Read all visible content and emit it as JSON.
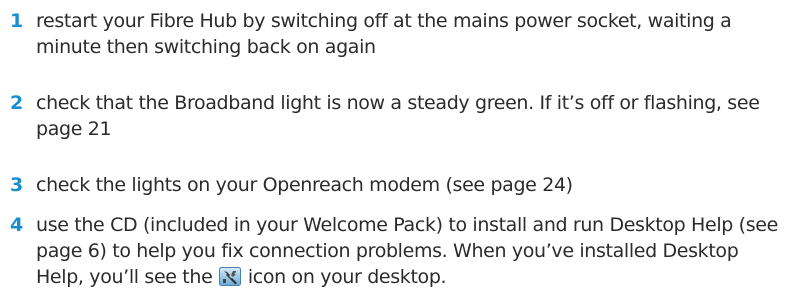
{
  "steps": [
    {
      "number": "1",
      "text": "restart your Fibre Hub by switching off at the mains power socket, waiting a minute then switching back on again"
    },
    {
      "number": "2",
      "text": "check that the Broadband light is now a steady green. If it’s off or flashing, see page 21"
    },
    {
      "number": "3",
      "text": "check the lights on your Openreach modem (see page 24)"
    },
    {
      "number": "4",
      "text_before_icon": "use the CD (included in your Welcome Pack) to install and run Desktop Help (see page 6) to help you fix connection problems. When you’ve installed Desktop Help, you’ll see the",
      "icon": "desktop-help-icon",
      "text_after_icon": "icon on your desktop."
    }
  ],
  "colors": {
    "step_number": "#1a8fd0",
    "body_text": "#2b2b2b"
  }
}
